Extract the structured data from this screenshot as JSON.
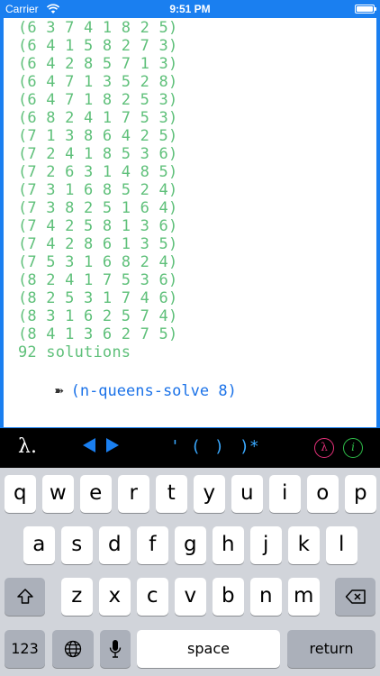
{
  "status_bar": {
    "carrier": "Carrier",
    "time": "9:51 PM"
  },
  "console": {
    "output_lines": [
      "(6 3 7 4 1 8 2 5)",
      "(6 4 1 5 8 2 7 3)",
      "(6 4 2 8 5 7 1 3)",
      "(6 4 7 1 3 5 2 8)",
      "(6 4 7 1 8 2 5 3)",
      "(6 8 2 4 1 7 5 3)",
      "(7 1 3 8 6 4 2 5)",
      "(7 2 4 1 8 5 3 6)",
      "(7 2 6 3 1 4 8 5)",
      "(7 3 1 6 8 5 2 4)",
      "(7 3 8 2 5 1 6 4)",
      "(7 4 2 5 8 1 3 6)",
      "(7 4 2 8 6 1 3 5)",
      "(7 5 3 1 6 8 2 4)",
      "(8 2 4 1 7 5 3 6)",
      "(8 2 5 3 1 7 4 6)",
      "(8 3 1 6 2 5 7 4)",
      "(8 4 1 3 6 2 7 5)",
      "92 solutions"
    ],
    "prompt_arrow": "➽",
    "input_text": "(n-queens-solve 8)"
  },
  "toolbar": {
    "lambda_label": "λ.",
    "quote_label": "'",
    "open_paren_label": "(",
    "close_paren_label": ")",
    "close_all_label": ")*",
    "lambda_circle_label": "λ",
    "info_circle_label": "i"
  },
  "keyboard": {
    "row1": [
      "q",
      "w",
      "e",
      "r",
      "t",
      "y",
      "u",
      "i",
      "o",
      "p"
    ],
    "row2": [
      "a",
      "s",
      "d",
      "f",
      "g",
      "h",
      "j",
      "k",
      "l"
    ],
    "row3": [
      "z",
      "x",
      "c",
      "v",
      "b",
      "n",
      "m"
    ],
    "numbers_label": "123",
    "space_label": "space",
    "return_label": "return",
    "icons": {
      "shift": "shift-icon",
      "delete": "delete-icon",
      "globe": "globe-icon",
      "mic": "microphone-icon"
    }
  },
  "colors": {
    "accent": "#1a7ff0",
    "output_text": "#5fc07a",
    "prompt_text": "#1b72e8",
    "toolbar_symbol": "#3aa9ff",
    "lambda_circle": "#e8317b",
    "info_circle": "#2fbf4a"
  }
}
